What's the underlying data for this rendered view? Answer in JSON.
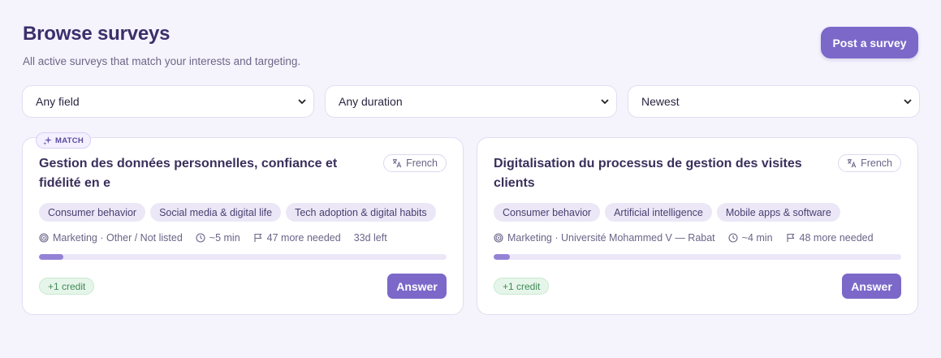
{
  "header": {
    "title": "Browse surveys",
    "subtitle": "All active surveys that match your interests and targeting.",
    "post_button": "Post a survey"
  },
  "filters": {
    "field": "Any field",
    "duration": "Any duration",
    "sort": "Newest"
  },
  "colors": {
    "accent": "#7b68c9",
    "background": "#f5f3fc",
    "credit_green": "#3f8a55"
  },
  "surveys": [
    {
      "badge": "MATCH",
      "title": "Gestion des données personnelles, confiance et fidélité en e",
      "language": "French",
      "tags": [
        "Consumer behavior",
        "Social media & digital life",
        "Tech adoption & digital habits"
      ],
      "field": "Marketing · Other / Not listed",
      "duration": "~5 min",
      "needed": "47 more needed",
      "deadline": "33d left",
      "progress": 0.06,
      "credit": "+1 credit",
      "action": "Answer"
    },
    {
      "title": "Digitalisation du processus de gestion des visites clients",
      "language": "French",
      "tags": [
        "Consumer behavior",
        "Artificial intelligence",
        "Mobile apps & software"
      ],
      "field": "Marketing · Université Mohammed V — Rabat",
      "duration": "~4 min",
      "needed": "48 more needed",
      "progress": 0.04,
      "credit": "+1 credit",
      "action": "Answer"
    }
  ]
}
